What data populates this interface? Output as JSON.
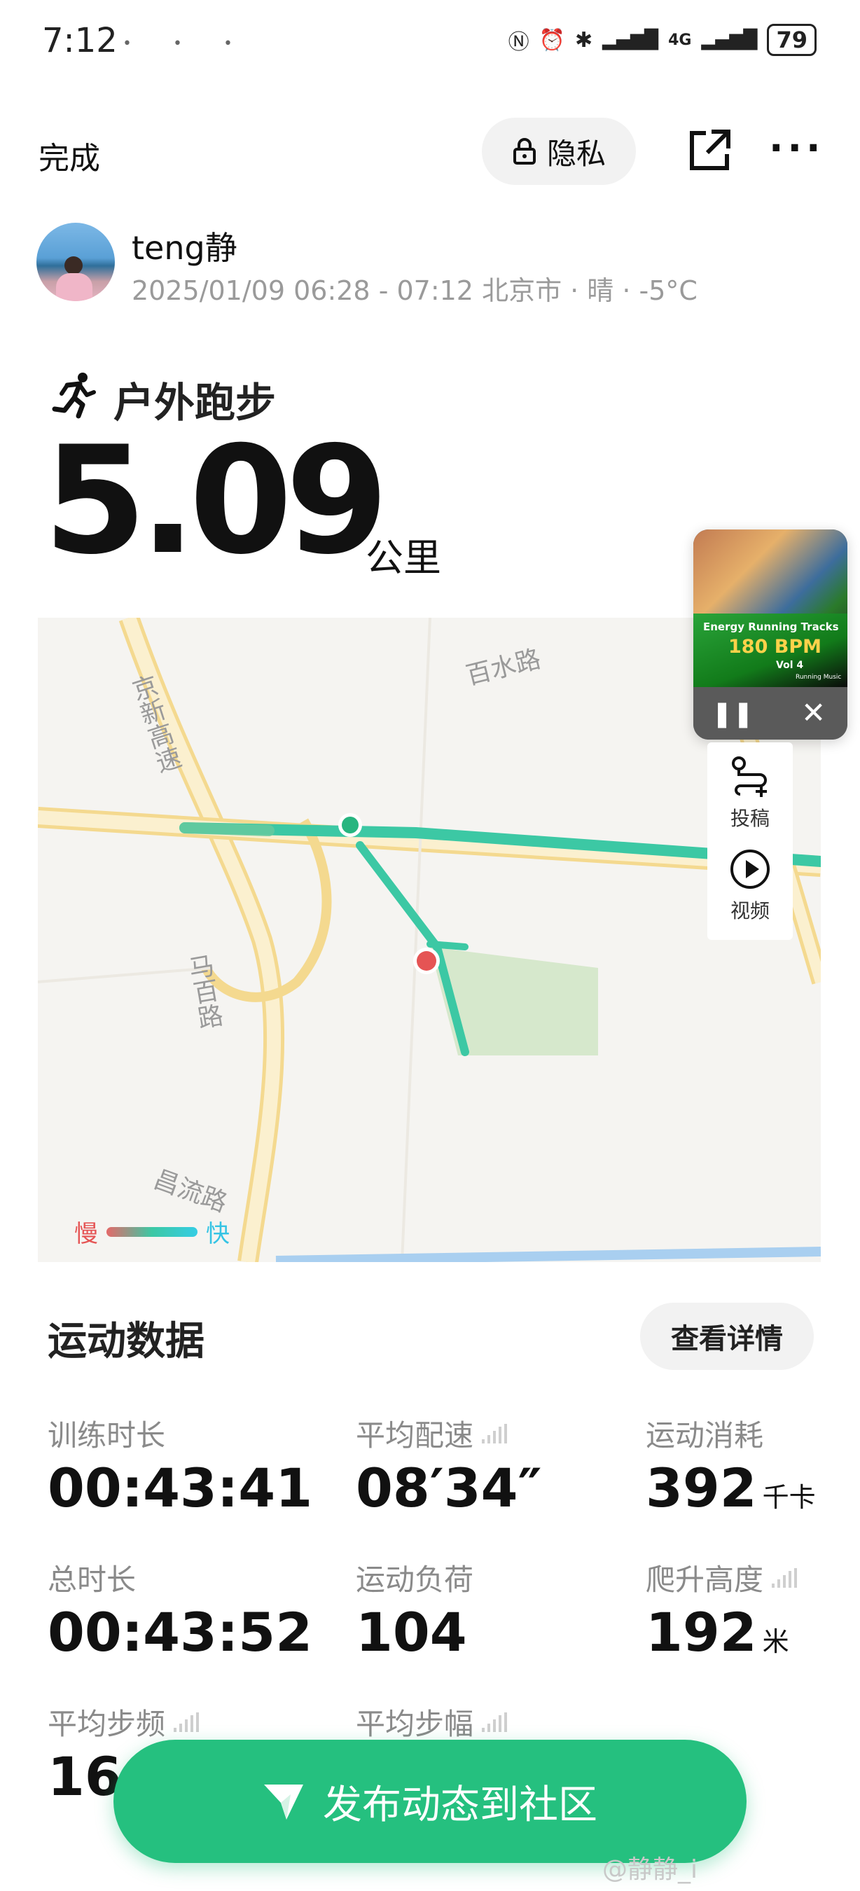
{
  "status_bar": {
    "time": "7:12",
    "network": "4G",
    "battery": "79"
  },
  "topbar": {
    "done_label": "完成",
    "privacy_label": "隐私"
  },
  "user": {
    "name": "teng静",
    "meta": "2025/01/09 06:28 - 07:12 北京市 · 晴 · -5°C"
  },
  "activity": {
    "type": "户外跑步",
    "distance": "5.09",
    "unit": "公里"
  },
  "map": {
    "labels": [
      "百水路",
      "京新高速",
      "马百路",
      "昌流路"
    ],
    "legend": {
      "slow": "慢",
      "fast": "快"
    }
  },
  "music": {
    "line1": "Energy Running Tracks",
    "line2": "180 BPM",
    "line3": "Vol 4",
    "line4": "Running Music"
  },
  "side_panel": {
    "submit_label": "投稿",
    "video_label": "视频"
  },
  "stats": {
    "section_title": "运动数据",
    "details_label": "查看详情",
    "items": [
      {
        "label": "训练时长",
        "value": "00:43:41",
        "unit": ""
      },
      {
        "label": "平均配速",
        "value": "08′34″",
        "unit": ""
      },
      {
        "label": "运动消耗",
        "value": "392",
        "unit": "千卡"
      },
      {
        "label": "总时长",
        "value": "00:43:52",
        "unit": ""
      },
      {
        "label": "运动负荷",
        "value": "104",
        "unit": ""
      },
      {
        "label": "爬升高度",
        "value": "192",
        "unit": "米"
      },
      {
        "label": "平均步频",
        "value": "164",
        "unit": ""
      },
      {
        "label": "平均步幅",
        "value": "",
        "unit": ""
      }
    ]
  },
  "bottom": {
    "publish_label": "发布动态到社区",
    "watermark": "@静静_i"
  },
  "colors": {
    "accent_green": "#25c07f",
    "route_green": "#3cc8a4",
    "start_marker": "#e55454"
  }
}
